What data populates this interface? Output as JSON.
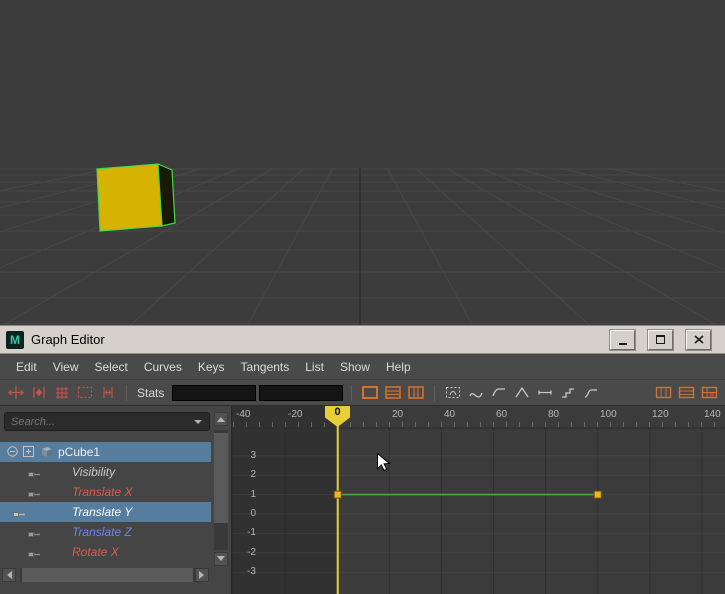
{
  "viewport": {
    "object_label": "pCube1",
    "cube_color": "#d6b300",
    "selection_color": "#49d849"
  },
  "window": {
    "title": "Graph Editor"
  },
  "menu_bar": {
    "items": [
      "Edit",
      "View",
      "Select",
      "Curves",
      "Keys",
      "Tangents",
      "List",
      "Show",
      "Help"
    ]
  },
  "toolbar": {
    "stats_label": "Stats",
    "stats_fields": [
      "",
      ""
    ],
    "icons": [
      "move-nearest-picked-key-tool",
      "insert-keys-tool",
      "lattice-deform-keys-tool",
      "region-keys-tool",
      "retime-tool",
      "absolute-view",
      "stacked-view",
      "normalized-view",
      "auto-tangent",
      "spline-tangent",
      "clamped-tangent",
      "linear-tangent",
      "flat-tangent",
      "step-tangent",
      "plateau-tangent",
      "time-snap",
      "value-snap",
      "grid-snap"
    ]
  },
  "outliner": {
    "search_placeholder": "Search...",
    "rows": [
      {
        "label": "pCube1",
        "color": "#f0f0f0",
        "selected": true
      },
      {
        "label": "Visibility",
        "color": "#c9c9c9",
        "selected": false
      },
      {
        "label": "Translate X",
        "color": "#d85c4f",
        "selected": false
      },
      {
        "label": "Translate Y",
        "color": "#ffffff",
        "selected": true
      },
      {
        "label": "Translate Z",
        "color": "#6d84e8",
        "selected": false
      },
      {
        "label": "Rotate X",
        "color": "#d85c4f",
        "selected": false
      }
    ]
  },
  "graph": {
    "time_ticks": [
      "-40",
      "-20",
      "0",
      "20",
      "40",
      "60",
      "80",
      "100",
      "120",
      "140"
    ],
    "value_ticks": [
      "3",
      "2",
      "1",
      "0",
      "-1",
      "-2",
      "-3"
    ],
    "current_time": "0",
    "playhead_color": "#e8cf3a",
    "curve": {
      "channel": "Translate Y",
      "color": "#4aa54a",
      "key_color": "#f0b428",
      "keys": [
        {
          "frame": 0,
          "value": 1
        },
        {
          "frame": 100,
          "value": 1
        }
      ]
    }
  },
  "chart_data": {
    "type": "line",
    "series": [
      {
        "name": "pCube1 Translate Y",
        "x": [
          0,
          100
        ],
        "y": [
          1,
          1
        ]
      }
    ],
    "xlim": [
      -52,
      149
    ],
    "ylim": [
      -3.6,
      3.9
    ]
  }
}
